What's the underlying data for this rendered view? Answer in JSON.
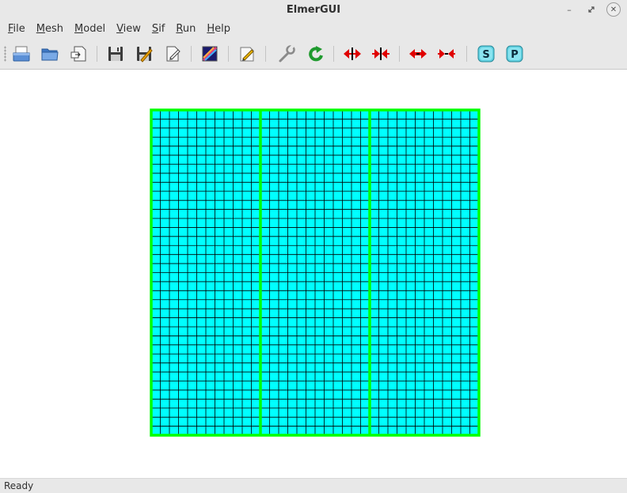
{
  "window": {
    "title": "ElmerGUI"
  },
  "menubar": {
    "items": [
      {
        "mnemonic": "F",
        "rest": "ile"
      },
      {
        "mnemonic": "M",
        "rest": "esh"
      },
      {
        "mnemonic": "M",
        "rest": "odel"
      },
      {
        "mnemonic": "V",
        "rest": "iew"
      },
      {
        "mnemonic": "S",
        "rest": "if"
      },
      {
        "mnemonic": "R",
        "rest": "un"
      },
      {
        "mnemonic": "H",
        "rest": "elp"
      }
    ]
  },
  "toolbar": {
    "buttons": [
      {
        "icon": "open-icon"
      },
      {
        "icon": "load-mesh-icon"
      },
      {
        "icon": "load-project-icon"
      },
      {
        "icon": "save-icon"
      },
      {
        "icon": "save-as-icon"
      },
      {
        "icon": "save-project-icon"
      },
      {
        "icon": "generate-mesh-icon"
      },
      {
        "icon": "edit-definitions-icon"
      },
      {
        "icon": "settings-icon"
      },
      {
        "icon": "refresh-icon"
      },
      {
        "icon": "unify-surface-icon"
      },
      {
        "icon": "divide-surface-icon"
      },
      {
        "icon": "unify-edge-icon"
      },
      {
        "icon": "divide-edge-icon"
      },
      {
        "icon": "solver-icon"
      },
      {
        "icon": "postprocessor-icon"
      }
    ],
    "solver_letter": "S",
    "post_letter": "P"
  },
  "mesh": {
    "fill_color": "#00ffff",
    "element_edge_color": "#000000",
    "boundary_color": "#00ff00",
    "columns": 36,
    "rows": 36,
    "bodies": 3
  },
  "status": {
    "text": "Ready"
  }
}
